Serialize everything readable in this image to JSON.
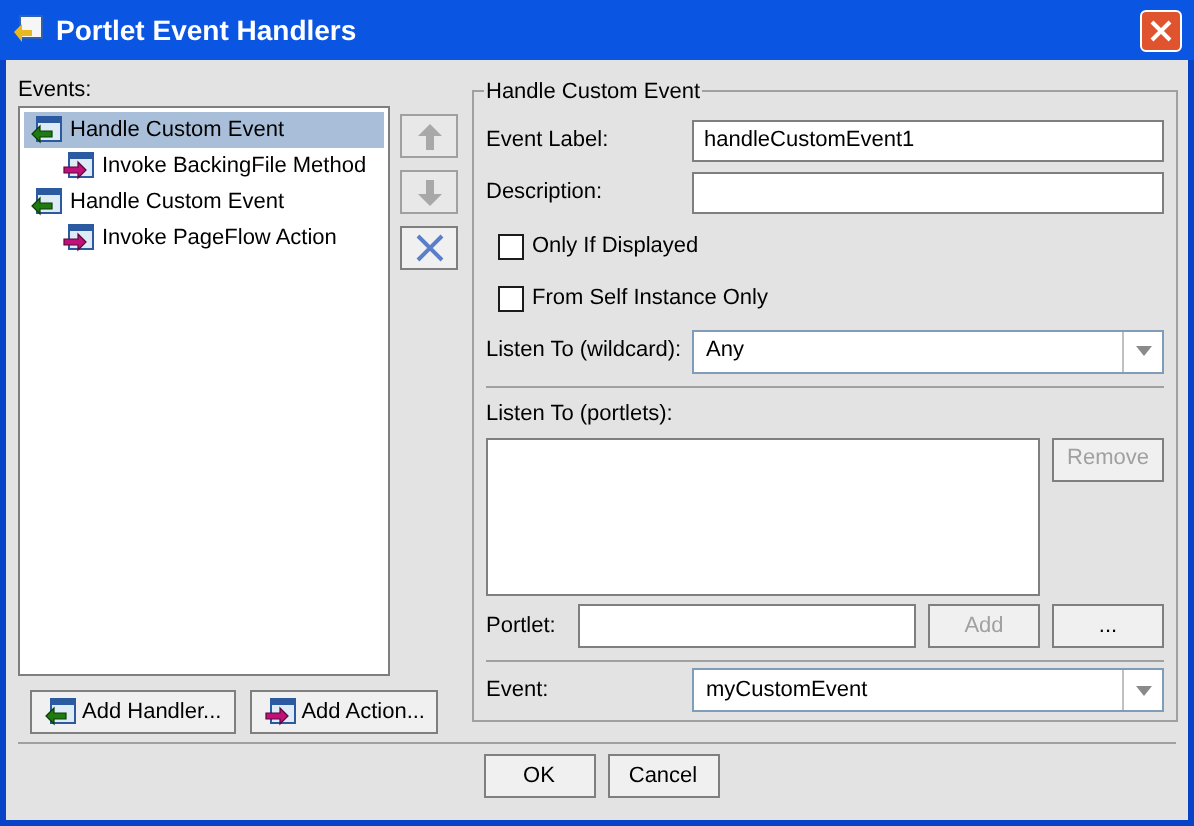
{
  "window": {
    "title": "Portlet Event Handlers"
  },
  "events": {
    "label": "Events:",
    "tree": [
      {
        "label": "Handle Custom Event",
        "kind": "handler",
        "selected": true,
        "children": [
          {
            "label": "Invoke BackingFile Method",
            "kind": "action",
            "selected": false
          }
        ]
      },
      {
        "label": "Handle Custom Event",
        "kind": "handler",
        "selected": false,
        "children": [
          {
            "label": "Invoke PageFlow Action",
            "kind": "action",
            "selected": false
          }
        ]
      }
    ]
  },
  "move_buttons": [
    {
      "kind": "up",
      "disabled": true
    },
    {
      "kind": "down",
      "disabled": true
    },
    {
      "kind": "delete",
      "disabled": false
    }
  ],
  "add_buttons": [
    {
      "label": "Add Handler...",
      "kind": "handler"
    },
    {
      "label": "Add Action...",
      "kind": "action"
    }
  ],
  "details": {
    "title": "Handle Custom Event",
    "event_label": {
      "label": "Event Label:",
      "value": "handleCustomEvent1"
    },
    "description": {
      "label": "Description:"
    },
    "checkboxes": [
      {
        "label": "Only If Displayed",
        "checked": false
      },
      {
        "label": "From Self Instance Only",
        "checked": false
      }
    ],
    "listen_wildcard": {
      "label": "Listen To (wildcard):",
      "value": "Any"
    },
    "listen_portlets": {
      "label": "Listen To (portlets):",
      "remove": {
        "label": "Remove",
        "disabled": true
      }
    },
    "portlet": {
      "label": "Portlet:",
      "add": {
        "label": "Add",
        "disabled": true
      },
      "browse": {
        "label": "..."
      }
    },
    "event": {
      "label": "Event:",
      "value": "myCustomEvent"
    }
  },
  "buttons": [
    {
      "label": "OK"
    },
    {
      "label": "Cancel"
    }
  ]
}
